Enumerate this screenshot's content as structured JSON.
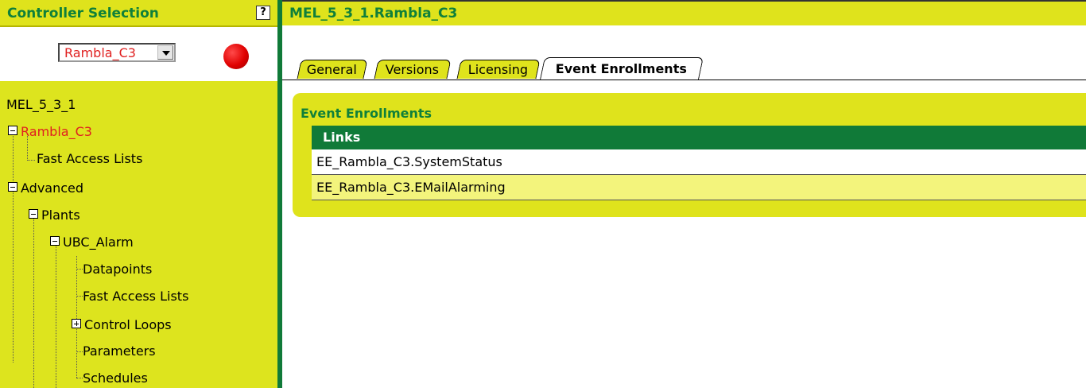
{
  "controller_selection": {
    "title": "Controller Selection",
    "help_label": "?",
    "selected_controller": "Rambla_C3",
    "status_color": "#e00000"
  },
  "tree": {
    "root": "MEL_5_3_1",
    "controller": "Rambla_C3",
    "fast_access_lists_1": "Fast Access Lists",
    "advanced": "Advanced",
    "plants": "Plants",
    "ubc_alarm": "UBC_Alarm",
    "datapoints": "Datapoints",
    "fast_access_lists_2": "Fast Access Lists",
    "control_loops": "Control Loops",
    "parameters": "Parameters",
    "schedules": "Schedules"
  },
  "document": {
    "title": "MEL_5_3_1.Rambla_C3"
  },
  "tabs": {
    "general": "General",
    "versions": "Versions",
    "licensing": "Licensing",
    "event_enrollments": "Event Enrollments",
    "active": "Event Enrollments"
  },
  "event_enrollments": {
    "title": "Event Enrollments",
    "table_header": "Links",
    "rows": [
      "EE_Rambla_C3.SystemStatus",
      "EE_Rambla_C3.EMailAlarming"
    ]
  },
  "colors": {
    "accent_yellow": "#dfe31c",
    "accent_green": "#107a38",
    "selected_text": "#e02020"
  }
}
